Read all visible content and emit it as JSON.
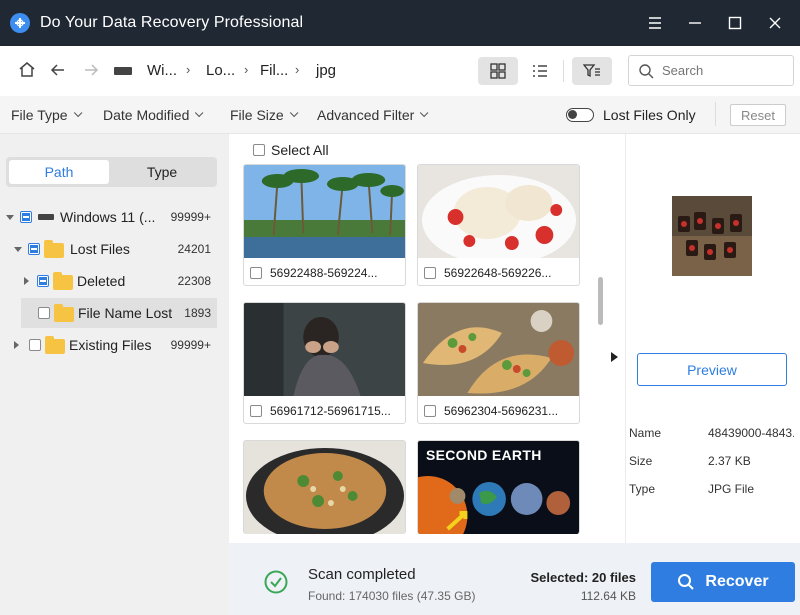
{
  "window": {
    "title": "Do Your Data Recovery  Professional",
    "controls": [
      "menu-icon",
      "minimize-icon",
      "maximize-icon",
      "close-icon"
    ]
  },
  "nav": {
    "breadcrumb": [
      "Wi...",
      "Lo...",
      "Fil...",
      "jpg"
    ],
    "search_placeholder": "Search"
  },
  "filters": {
    "items": [
      "File Type",
      "File Size",
      "Date Modified",
      "Advanced Filter"
    ],
    "lost_files_only_label": "Lost Files Only",
    "lost_files_only_on": false,
    "reset_label": "Reset"
  },
  "left": {
    "tabs": [
      "Path",
      "Type"
    ],
    "active_tab": "Path",
    "tree": [
      {
        "label": "Windows 11 (...",
        "count": "99999+"
      },
      {
        "label": "Lost Files",
        "count": "24201"
      },
      {
        "label": "Deleted",
        "count": "22308"
      },
      {
        "label": "File Name Lost",
        "count": "1893"
      },
      {
        "label": "Existing Files",
        "count": "99999+"
      }
    ]
  },
  "grid": {
    "select_all_label": "Select All",
    "items": [
      {
        "name": "56922488-569224...",
        "thumb": "palm-trees-lake"
      },
      {
        "name": "56922648-569226...",
        "thumb": "ice-cream-strawberries"
      },
      {
        "name": "56961712-56961715...",
        "thumb": "distressed-woman"
      },
      {
        "name": "56962304-5696231...",
        "thumb": "tacos"
      },
      {
        "name": "",
        "thumb": "noodle-salad"
      },
      {
        "name": "",
        "thumb": "second-earth",
        "overlay_text": "SECOND EARTH"
      }
    ]
  },
  "details": {
    "preview_label": "Preview",
    "name_key": "Name",
    "name_value": "48439000-4843...",
    "size_key": "Size",
    "size_value": "2.37 KB",
    "type_key": "Type",
    "type_value": "JPG File"
  },
  "status": {
    "title": "Scan completed",
    "found": "Found: 174030 files (47.35 GB)",
    "selected": "Selected: 20 files",
    "selected_size": "112.64 KB",
    "recover_label": "Recover"
  },
  "colors": {
    "titlebar": "#202833",
    "accent": "#2f7de1",
    "folder": "#f6c343",
    "success": "#3aa757"
  }
}
